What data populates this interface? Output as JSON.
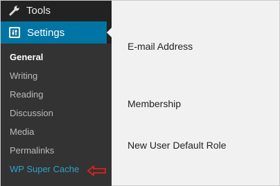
{
  "sidebar": {
    "tools_label": "Tools",
    "tools_icon": "wrench-icon",
    "settings_label": "Settings",
    "settings_icon": "settings-sliders-icon",
    "submenu": [
      {
        "label": "General",
        "state": "current"
      },
      {
        "label": "Writing",
        "state": "normal"
      },
      {
        "label": "Reading",
        "state": "normal"
      },
      {
        "label": "Discussion",
        "state": "normal"
      },
      {
        "label": "Media",
        "state": "normal"
      },
      {
        "label": "Permalinks",
        "state": "normal"
      },
      {
        "label": "WP Super Cache",
        "state": "highlighted"
      }
    ],
    "annotation_icon": "red-arrow-left-icon"
  },
  "main": {
    "fields": [
      "E-mail Address",
      "Membership",
      "New User Default Role"
    ]
  },
  "colors": {
    "sidebar_bg": "#222222",
    "submenu_bg": "#333333",
    "settings_active_bg": "#0074a2",
    "plugin_link": "#2ea2cc",
    "annotation_red": "#e0201b",
    "content_bg": "#f1f1f1"
  }
}
